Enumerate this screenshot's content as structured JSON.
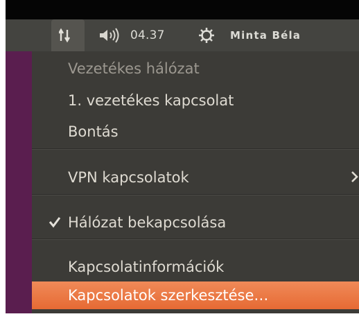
{
  "panel": {
    "network_icon": "network-up-down-icon",
    "sound_icon": "speaker-volume-icon",
    "clock": "04.37",
    "session_icon": "power-gear-icon",
    "user": "Minta Béla"
  },
  "menu": {
    "header": "Vezetékes hálózat",
    "wired_connection": "1. vezetékes kapcsolat",
    "disconnect": "Bontás",
    "vpn": "VPN kapcsolatok",
    "enable_networking": "Hálózat bekapcsolása",
    "connection_info": "Kapcsolatinformációk",
    "edit_connections": "Kapcsolatok szerkesztése…"
  },
  "colors": {
    "highlight": "#e86f3a",
    "menu_background": "#3c3b37",
    "panel_background": "#444440",
    "desktop": "#5a1e4f"
  }
}
